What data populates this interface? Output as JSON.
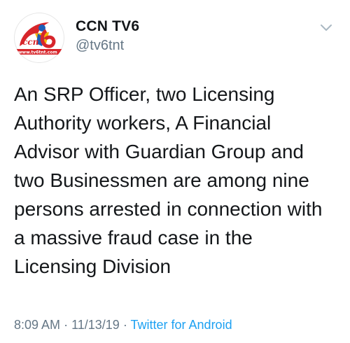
{
  "account": {
    "display_name": "CCN TV6",
    "handle": "@tv6tnt",
    "avatar_url_text": "www.tv6tnt.com",
    "avatar_logo_text": "ccn"
  },
  "tweet": {
    "text": "An SRP Officer, two Licensing\nAuthority workers, A Financial\nAdvisor with Guardian Group and\ntwo Businessmen are among nine\npersons arrested in connection with\na massive fraud case in the\nLicensing Division",
    "time": "8:09 AM",
    "date": "11/13/19",
    "separator": "·",
    "source": "Twitter for Android"
  },
  "icons": {
    "caret": "chevron-down-icon"
  },
  "colors": {
    "text": "#14171a",
    "muted": "#657786",
    "link": "#1da1f2",
    "logo_red": "#d7262b"
  }
}
